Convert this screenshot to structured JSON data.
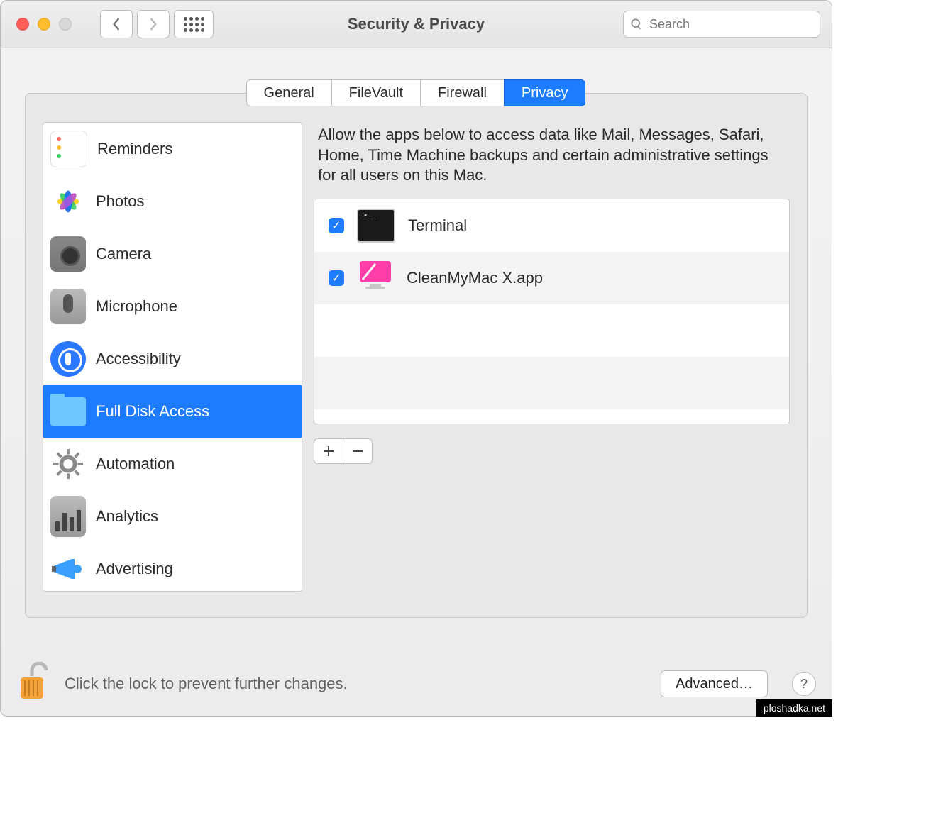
{
  "window": {
    "title": "Security & Privacy"
  },
  "search": {
    "placeholder": "Search"
  },
  "tabs": [
    {
      "label": "General",
      "selected": false
    },
    {
      "label": "FileVault",
      "selected": false
    },
    {
      "label": "Firewall",
      "selected": false
    },
    {
      "label": "Privacy",
      "selected": true
    }
  ],
  "sidebar": [
    {
      "label": "Reminders",
      "icon": "reminders-icon",
      "selected": false
    },
    {
      "label": "Photos",
      "icon": "photos-icon",
      "selected": false
    },
    {
      "label": "Camera",
      "icon": "camera-icon",
      "selected": false
    },
    {
      "label": "Microphone",
      "icon": "microphone-icon",
      "selected": false
    },
    {
      "label": "Accessibility",
      "icon": "accessibility-icon",
      "selected": false
    },
    {
      "label": "Full Disk Access",
      "icon": "folder-icon",
      "selected": true
    },
    {
      "label": "Automation",
      "icon": "gear-icon",
      "selected": false
    },
    {
      "label": "Analytics",
      "icon": "chart-icon",
      "selected": false
    },
    {
      "label": "Advertising",
      "icon": "megaphone-icon",
      "selected": false
    }
  ],
  "main": {
    "description": "Allow the apps below to access data like Mail, Messages, Safari, Home, Time Machine backups and certain administrative settings for all users on this Mac.",
    "apps": [
      {
        "name": "Terminal",
        "checked": true,
        "icon": "terminal-icon"
      },
      {
        "name": "CleanMyMac X.app",
        "checked": true,
        "icon": "cleanmymac-icon"
      }
    ]
  },
  "footer": {
    "lock_label": "Click the lock to prevent further changes.",
    "advanced_label": "Advanced…",
    "help_label": "?"
  },
  "watermark": "ploshadka.net"
}
